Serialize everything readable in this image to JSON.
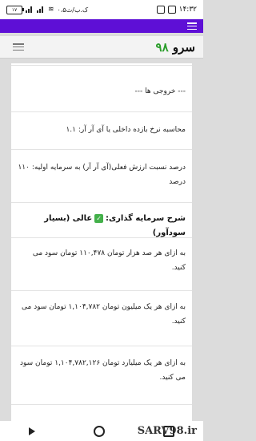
{
  "status_bar": {
    "time": "۱۴:۳۲",
    "network_speed": "۰،۵ک.ب/ث",
    "battery_level": "۱۷"
  },
  "site": {
    "logo_word": "سرو",
    "logo_number": "۹۸"
  },
  "content": {
    "outputs_heading": "--- خروجی ها ---",
    "irr_line": "محاسبه نرخ بازده داخلی یا آی آر آر: ۱.۱",
    "ratio_line": "درصد نسبت ارزش فعلی(آی آر آر) به سرمایه اولیه: ۱۱۰ درصد",
    "description_label": "شرح سرمایه گذاری:",
    "description_value": "عالی (بسیار سودآور)",
    "profit_lines": [
      "به ازای هر صد هزار تومان ۱۱۰,۴۷۸ تومان سود می کنید.",
      "به ازای هر یک میلیون تومان ۱,۱۰۴,۷۸۲ تومان سود می کنید.",
      "به ازای هر یک میلیارد تومان ۱,۱۰۴,۷۸۲,۱۲۶ تومان سود می کنید."
    ]
  },
  "watermark": "SARV98.ir",
  "colors": {
    "app_bar": "#5e0fd6",
    "logo_number": "#2a9d2a",
    "check": "#43b04a"
  }
}
